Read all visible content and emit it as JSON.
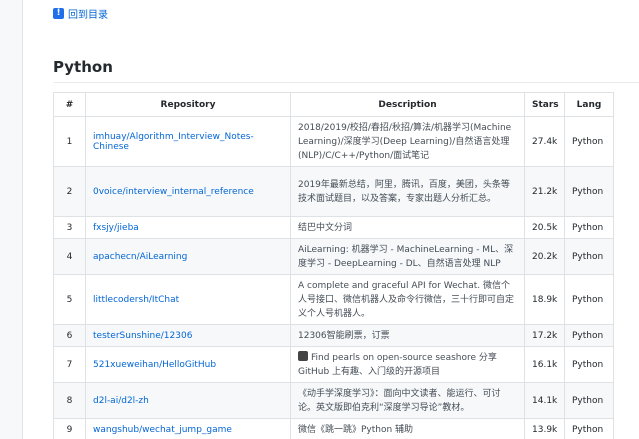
{
  "nav": {
    "back_label": "回到目录"
  },
  "section": {
    "title": "Python"
  },
  "table": {
    "headers": {
      "num": "#",
      "repo": "Repository",
      "desc": "Description",
      "stars": "Stars",
      "lang": "Lang"
    },
    "rows": [
      {
        "num": "1",
        "repo": "imhuay/Algorithm_Interview_Notes-Chinese",
        "desc": "2018/2019/校招/春招/秋招/算法/机器学习(Machine Learning)/深度学习(Deep Learning)/自然语言处理(NLP)/C/C++/Python/面试笔记",
        "stars": "27.4k",
        "lang": "Python"
      },
      {
        "num": "2",
        "repo": "0voice/interview_internal_reference",
        "desc": "2019年最新总结，阿里，腾讯，百度，美团，头条等技术面试题目，以及答案，专家出题人分析汇总。",
        "stars": "21.2k",
        "lang": "Python"
      },
      {
        "num": "3",
        "repo": "fxsjy/jieba",
        "desc": "结巴中文分词",
        "stars": "20.5k",
        "lang": "Python"
      },
      {
        "num": "4",
        "repo": "apachecn/AiLearning",
        "desc": "AiLearning: 机器学习 - MachineLearning - ML、深度学习 - DeepLearning - DL、自然语言处理 NLP",
        "stars": "20.2k",
        "lang": "Python"
      },
      {
        "num": "5",
        "repo": "littlecodersh/ItChat",
        "desc": "A complete and graceful API for Wechat. 微信个人号接口、微信机器人及命令行微信，三十行即可自定义个人号机器人。",
        "stars": "18.9k",
        "lang": "Python"
      },
      {
        "num": "6",
        "repo": "testerSunshine/12306",
        "desc": "12306智能刷票，订票",
        "stars": "17.2k",
        "lang": "Python"
      },
      {
        "num": "7",
        "repo": "521xueweihan/HelloGitHub",
        "desc": "Find pearls on open-source seashore 分享 GitHub 上有趣、入门级的开源项目",
        "stars": "16.1k",
        "lang": "Python"
      },
      {
        "num": "8",
        "repo": "d2l-ai/d2l-zh",
        "desc": "《动手学深度学习》：面向中文读者、能运行、可讨论。英文版即伯克利“深度学习导论”教材。",
        "stars": "14.1k",
        "lang": "Python"
      },
      {
        "num": "9",
        "repo": "wangshub/wechat_jump_game",
        "desc": "微信《跳一跳》Python 辅助",
        "stars": "13.9k",
        "lang": "Python"
      }
    ]
  }
}
